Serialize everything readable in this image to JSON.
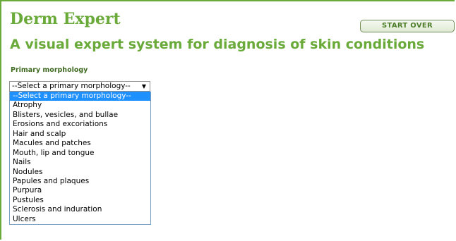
{
  "header": {
    "app_title": "Derm Expert",
    "start_over_label": "START OVER",
    "subtitle": "A visual expert system for diagnosis of skin conditions"
  },
  "form": {
    "label": "Primary morphology",
    "select": {
      "selected": "--Select a primary morphology--",
      "arrow_icon": "▼",
      "options": [
        "--Select a primary morphology--",
        "Atrophy",
        "Blisters, vesicles, and bullae",
        "Erosions and excoriations",
        "Hair and scalp",
        "Macules and patches",
        "Mouth, lip and tongue",
        "Nails",
        "Nodules",
        "Papules and plaques",
        "Purpura",
        "Pustules",
        "Sclerosis and induration",
        "Ulcers"
      ],
      "highlighted_index": 0
    }
  },
  "colors": {
    "brand_green": "#6aaa3a",
    "label_green": "#3f6b22",
    "highlight_blue": "#1e90ff"
  }
}
